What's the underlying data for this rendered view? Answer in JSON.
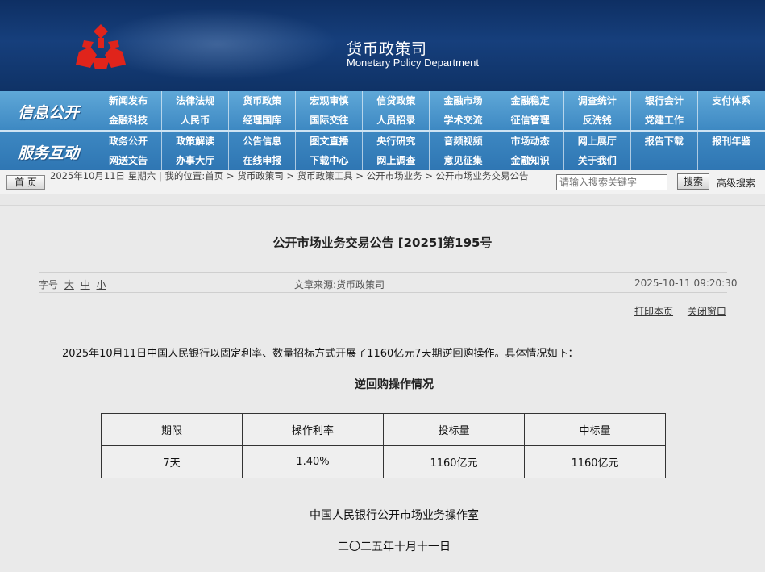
{
  "header": {
    "dept_cn": "货币政策司",
    "dept_en": "Monetary Policy Department",
    "logo_color": "#e0241b",
    "bg_color": "#163f7c"
  },
  "nav": {
    "section1_title": "信息公开",
    "section2_title": "服务互动",
    "row1": [
      "新闻发布",
      "法律法规",
      "货币政策",
      "宏观审慎",
      "信贷政策",
      "金融市场",
      "金融稳定",
      "调查统计",
      "银行会计",
      "支付体系"
    ],
    "row2": [
      "金融科技",
      "人民币",
      "经理国库",
      "国际交往",
      "人员招录",
      "学术交流",
      "征信管理",
      "反洗钱",
      "党建工作",
      ""
    ],
    "row3": [
      "政务公开",
      "政策解读",
      "公告信息",
      "图文直播",
      "央行研究",
      "音频视频",
      "市场动态",
      "网上展厅",
      "报告下载",
      "报刊年鉴"
    ],
    "row4": [
      "网送文告",
      "办事大厅",
      "在线申报",
      "下载中心",
      "网上调查",
      "意见征集",
      "金融知识",
      "关于我们",
      "",
      ""
    ]
  },
  "crumb": {
    "home_label": "首 页",
    "text": "2025年10月11日 星期六 | 我的位置:首页 > 货币政策司 > 货币政策工具 > 公开市场业务 > 公开市场业务交易公告",
    "search_placeholder": "请输入搜索关键字",
    "search_btn": "搜索",
    "adv_search": "高级搜索"
  },
  "article": {
    "title": "公开市场业务交易公告 [2025]第195号",
    "font_label": "字号",
    "font_large": "大",
    "font_medium": "中",
    "font_small": "小",
    "source": "文章来源:货币政策司",
    "datetime": "2025-10-11 09:20:30",
    "print_label": "打印本页",
    "close_label": "关闭窗口",
    "lead": "2025年10月11日中国人民银行以固定利率、数量招标方式开展了1160亿元7天期逆回购操作。具体情况如下：",
    "table_title": "逆回购操作情况",
    "table": {
      "headers": [
        "期限",
        "操作利率",
        "投标量",
        "中标量"
      ],
      "row": [
        "7天",
        "1.40%",
        "1160亿元",
        "1160亿元"
      ]
    },
    "signature": "中国人民银行公开市场业务操作室",
    "date_cn": "二〇二五年十月十一日"
  }
}
